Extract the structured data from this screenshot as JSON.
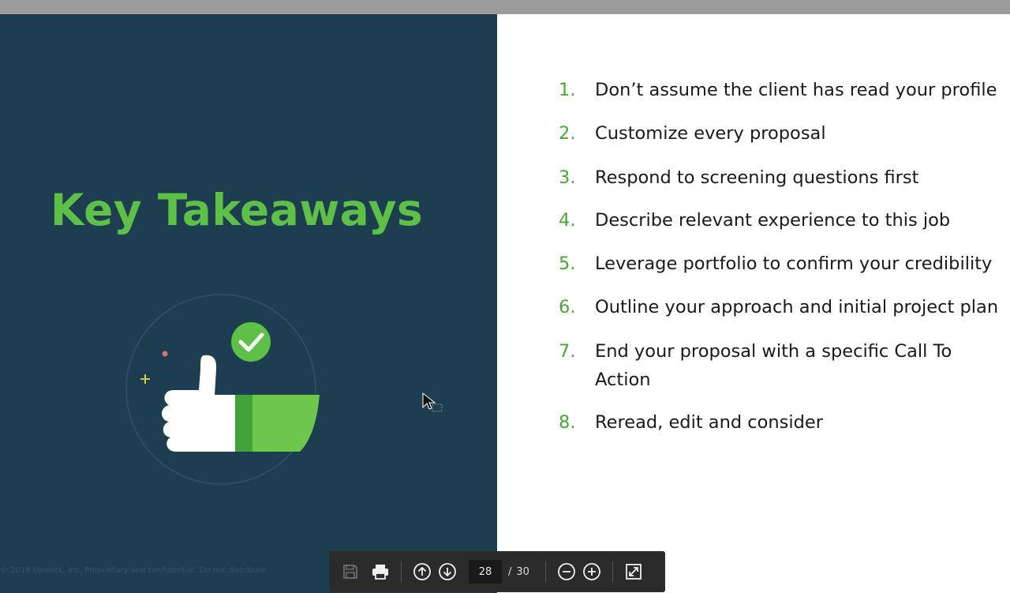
{
  "slide": {
    "title": "Key Takeaways",
    "footer": "© 2019 Upwork, Inc. Proprietary and confidential. Do not distribute.",
    "takeaways": [
      {
        "num": "1.",
        "text": "Don’t assume the client has read your profile"
      },
      {
        "num": "2.",
        "text": "Customize every proposal"
      },
      {
        "num": "3.",
        "text": "Respond to screening questions first"
      },
      {
        "num": "4.",
        "text": "Describe relevant experience to this job"
      },
      {
        "num": "5.",
        "text": "Leverage portfolio to confirm your credibility"
      },
      {
        "num": "6.",
        "text": "Outline your approach and initial project plan"
      },
      {
        "num": "7.",
        "text": "End your proposal with a specific Call To Action"
      },
      {
        "num": "8.",
        "text": "Reread, edit and consider"
      }
    ]
  },
  "toolbar": {
    "current_page": "28",
    "separator": "/",
    "total_pages": "30",
    "icons": [
      "save-icon",
      "print-icon",
      "arrow-up-icon",
      "arrow-down-icon",
      "zoom-out-icon",
      "zoom-in-icon",
      "fit-page-icon"
    ]
  },
  "colors": {
    "panel": "#1d3d51",
    "accent_green": "#5ec046",
    "toolbar": "#2b2b2b"
  }
}
